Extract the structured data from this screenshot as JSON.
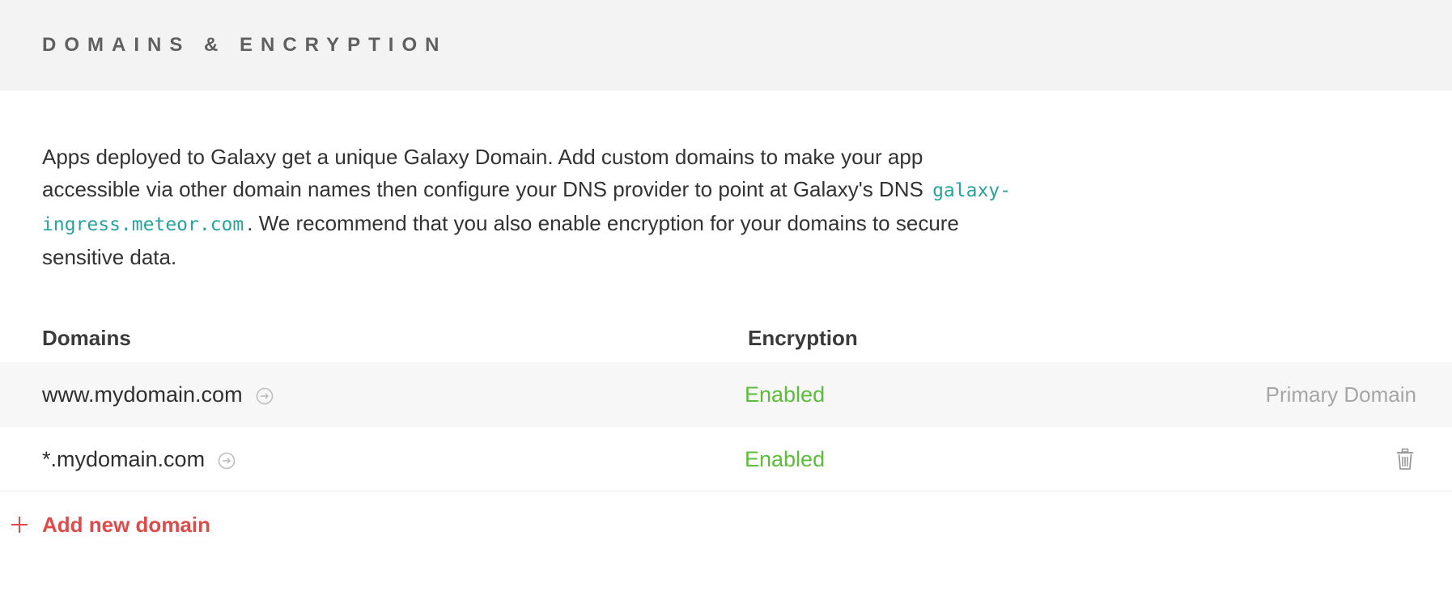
{
  "section": {
    "title": "DOMAINS & ENCRYPTION"
  },
  "intro": {
    "text_before": "Apps deployed to Galaxy get a unique Galaxy Domain. Add custom domains to make your app accessible via other domain names then configure your DNS provider to point at Galaxy's DNS",
    "dns_host": "galaxy-ingress.meteor.com",
    "text_after": ". We recommend that you also enable encryption for your domains to secure sensitive data."
  },
  "table": {
    "headers": {
      "domains": "Domains",
      "encryption": "Encryption"
    },
    "rows": [
      {
        "domain": "www.mydomain.com",
        "encryption": "Enabled",
        "right_label": "Primary Domain",
        "right_icon": ""
      },
      {
        "domain": "*.mydomain.com",
        "encryption": "Enabled",
        "right_label": "",
        "right_icon": "trash-icon"
      }
    ]
  },
  "actions": {
    "add_domain_label": "Add new domain"
  },
  "colors": {
    "header_bg": "#f3f3f3",
    "enabled": "#5cbd3a",
    "accent_red": "#de4b48",
    "dns_code": "#28a39b",
    "muted": "#a6a6a6"
  }
}
